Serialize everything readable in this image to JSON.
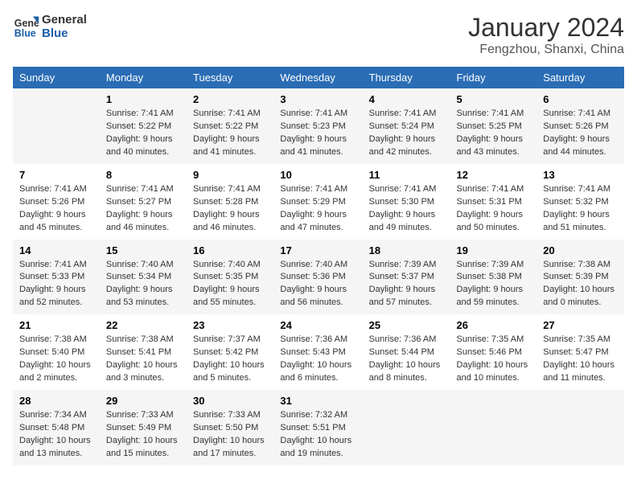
{
  "logo": {
    "line1": "General",
    "line2": "Blue"
  },
  "title": "January 2024",
  "subtitle": "Fengzhou, Shanxi, China",
  "days_of_week": [
    "Sunday",
    "Monday",
    "Tuesday",
    "Wednesday",
    "Thursday",
    "Friday",
    "Saturday"
  ],
  "weeks": [
    [
      {
        "day": "",
        "info": ""
      },
      {
        "day": "1",
        "info": "Sunrise: 7:41 AM\nSunset: 5:22 PM\nDaylight: 9 hours\nand 40 minutes."
      },
      {
        "day": "2",
        "info": "Sunrise: 7:41 AM\nSunset: 5:22 PM\nDaylight: 9 hours\nand 41 minutes."
      },
      {
        "day": "3",
        "info": "Sunrise: 7:41 AM\nSunset: 5:23 PM\nDaylight: 9 hours\nand 41 minutes."
      },
      {
        "day": "4",
        "info": "Sunrise: 7:41 AM\nSunset: 5:24 PM\nDaylight: 9 hours\nand 42 minutes."
      },
      {
        "day": "5",
        "info": "Sunrise: 7:41 AM\nSunset: 5:25 PM\nDaylight: 9 hours\nand 43 minutes."
      },
      {
        "day": "6",
        "info": "Sunrise: 7:41 AM\nSunset: 5:26 PM\nDaylight: 9 hours\nand 44 minutes."
      }
    ],
    [
      {
        "day": "7",
        "info": "Sunrise: 7:41 AM\nSunset: 5:26 PM\nDaylight: 9 hours\nand 45 minutes."
      },
      {
        "day": "8",
        "info": "Sunrise: 7:41 AM\nSunset: 5:27 PM\nDaylight: 9 hours\nand 46 minutes."
      },
      {
        "day": "9",
        "info": "Sunrise: 7:41 AM\nSunset: 5:28 PM\nDaylight: 9 hours\nand 46 minutes."
      },
      {
        "day": "10",
        "info": "Sunrise: 7:41 AM\nSunset: 5:29 PM\nDaylight: 9 hours\nand 47 minutes."
      },
      {
        "day": "11",
        "info": "Sunrise: 7:41 AM\nSunset: 5:30 PM\nDaylight: 9 hours\nand 49 minutes."
      },
      {
        "day": "12",
        "info": "Sunrise: 7:41 AM\nSunset: 5:31 PM\nDaylight: 9 hours\nand 50 minutes."
      },
      {
        "day": "13",
        "info": "Sunrise: 7:41 AM\nSunset: 5:32 PM\nDaylight: 9 hours\nand 51 minutes."
      }
    ],
    [
      {
        "day": "14",
        "info": "Sunrise: 7:41 AM\nSunset: 5:33 PM\nDaylight: 9 hours\nand 52 minutes."
      },
      {
        "day": "15",
        "info": "Sunrise: 7:40 AM\nSunset: 5:34 PM\nDaylight: 9 hours\nand 53 minutes."
      },
      {
        "day": "16",
        "info": "Sunrise: 7:40 AM\nSunset: 5:35 PM\nDaylight: 9 hours\nand 55 minutes."
      },
      {
        "day": "17",
        "info": "Sunrise: 7:40 AM\nSunset: 5:36 PM\nDaylight: 9 hours\nand 56 minutes."
      },
      {
        "day": "18",
        "info": "Sunrise: 7:39 AM\nSunset: 5:37 PM\nDaylight: 9 hours\nand 57 minutes."
      },
      {
        "day": "19",
        "info": "Sunrise: 7:39 AM\nSunset: 5:38 PM\nDaylight: 9 hours\nand 59 minutes."
      },
      {
        "day": "20",
        "info": "Sunrise: 7:38 AM\nSunset: 5:39 PM\nDaylight: 10 hours\nand 0 minutes."
      }
    ],
    [
      {
        "day": "21",
        "info": "Sunrise: 7:38 AM\nSunset: 5:40 PM\nDaylight: 10 hours\nand 2 minutes."
      },
      {
        "day": "22",
        "info": "Sunrise: 7:38 AM\nSunset: 5:41 PM\nDaylight: 10 hours\nand 3 minutes."
      },
      {
        "day": "23",
        "info": "Sunrise: 7:37 AM\nSunset: 5:42 PM\nDaylight: 10 hours\nand 5 minutes."
      },
      {
        "day": "24",
        "info": "Sunrise: 7:36 AM\nSunset: 5:43 PM\nDaylight: 10 hours\nand 6 minutes."
      },
      {
        "day": "25",
        "info": "Sunrise: 7:36 AM\nSunset: 5:44 PM\nDaylight: 10 hours\nand 8 minutes."
      },
      {
        "day": "26",
        "info": "Sunrise: 7:35 AM\nSunset: 5:46 PM\nDaylight: 10 hours\nand 10 minutes."
      },
      {
        "day": "27",
        "info": "Sunrise: 7:35 AM\nSunset: 5:47 PM\nDaylight: 10 hours\nand 11 minutes."
      }
    ],
    [
      {
        "day": "28",
        "info": "Sunrise: 7:34 AM\nSunset: 5:48 PM\nDaylight: 10 hours\nand 13 minutes."
      },
      {
        "day": "29",
        "info": "Sunrise: 7:33 AM\nSunset: 5:49 PM\nDaylight: 10 hours\nand 15 minutes."
      },
      {
        "day": "30",
        "info": "Sunrise: 7:33 AM\nSunset: 5:50 PM\nDaylight: 10 hours\nand 17 minutes."
      },
      {
        "day": "31",
        "info": "Sunrise: 7:32 AM\nSunset: 5:51 PM\nDaylight: 10 hours\nand 19 minutes."
      },
      {
        "day": "",
        "info": ""
      },
      {
        "day": "",
        "info": ""
      },
      {
        "day": "",
        "info": ""
      }
    ]
  ]
}
